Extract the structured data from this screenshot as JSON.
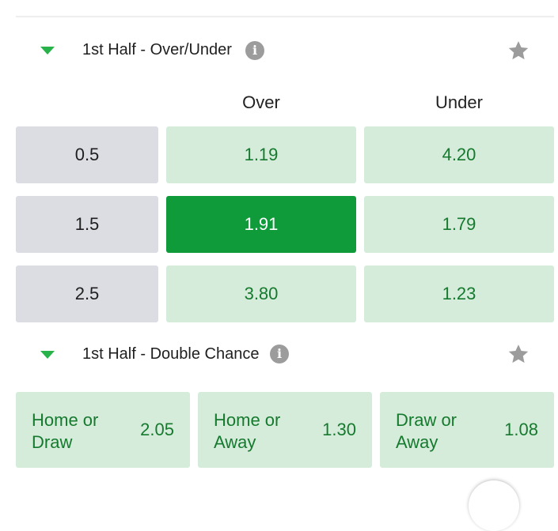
{
  "sections": {
    "over_under": {
      "title": "1st Half - Over/Under",
      "columns": [
        "Over",
        "Under"
      ],
      "rows": [
        {
          "line": "0.5",
          "over": "1.19",
          "under": "4.20",
          "selected": ""
        },
        {
          "line": "1.5",
          "over": "1.91",
          "under": "1.79",
          "selected": "over"
        },
        {
          "line": "2.5",
          "over": "3.80",
          "under": "1.23",
          "selected": ""
        }
      ]
    },
    "double_chance": {
      "title": "1st Half - Double Chance",
      "options": [
        {
          "label": "Home or Draw",
          "odds": "2.05"
        },
        {
          "label": "Home or Away",
          "odds": "1.30"
        },
        {
          "label": "Draw or Away",
          "odds": "1.08"
        }
      ]
    }
  },
  "icons": {
    "expand": "chevron-down-icon",
    "info": "info-icon",
    "favorite": "star-icon"
  },
  "colors": {
    "accent_green": "#27b34a",
    "odds_background": "#d6ecdb",
    "odds_text": "#157a2e",
    "selected_background": "#0f9b3a",
    "line_background": "#dcdde3",
    "icon_gray": "#9c9c9c"
  }
}
